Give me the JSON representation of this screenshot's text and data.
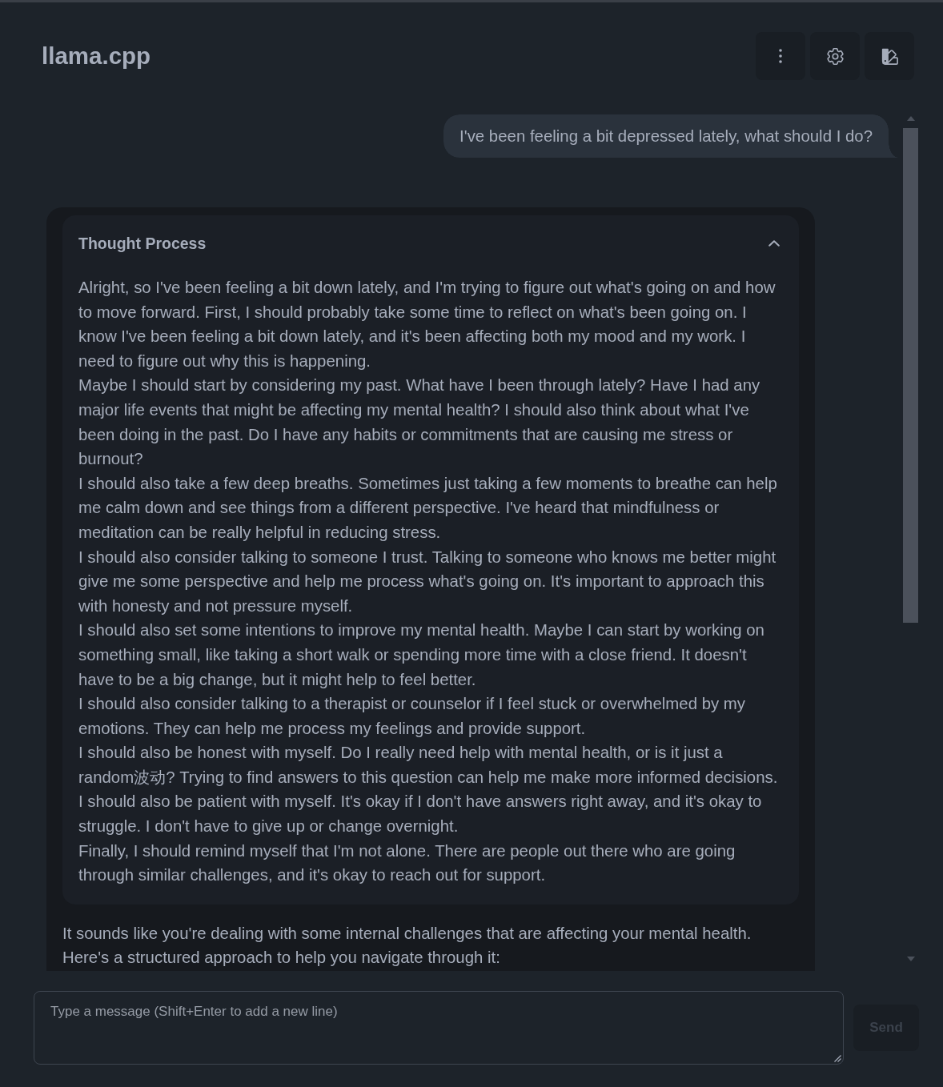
{
  "header": {
    "title": "llama.cpp"
  },
  "messages": [
    {
      "kind": "user",
      "text": "I've been feeling a bit depressed lately, what should I do?"
    },
    {
      "kind": "assistant",
      "thought": {
        "title": "Thought Process",
        "expanded": true,
        "paragraphs": [
          "Alright, so I've been feeling a bit down lately, and I'm trying to figure out what's going on and how to move forward. First, I should probably take some time to reflect on what's been going on. I know I've been feeling a bit down lately, and it's been affecting both my mood and my work. I need to figure out why this is happening.",
          "Maybe I should start by considering my past. What have I been through lately? Have I had any major life events that might be affecting my mental health? I should also think about what I've been doing in the past. Do I have any habits or commitments that are causing me stress or burnout?",
          "I should also take a few deep breaths. Sometimes just taking a few moments to breathe can help me calm down and see things from a different perspective. I've heard that mindfulness or meditation can be really helpful in reducing stress.",
          "I should also consider talking to someone I trust. Talking to someone who knows me better might give me some perspective and help me process what's going on. It's important to approach this with honesty and not pressure myself.",
          "I should also set some intentions to improve my mental health. Maybe I can start by working on something small, like taking a short walk or spending more time with a close friend. It doesn't have to be a big change, but it might help to feel better.",
          "I should also consider talking to a therapist or counselor if I feel stuck or overwhelmed by my emotions. They can help me process my feelings and provide support.",
          "I should also be honest with myself. Do I really need help with mental health, or is it just a random波动? Trying to find answers to this question can help me make more informed decisions.",
          "I should also be patient with myself. It's okay if I don't have answers right away, and it's okay to struggle. I don't have to give up or change overnight.",
          "Finally, I should remind myself that I'm not alone. There are people out there who are going through similar challenges, and it's okay to reach out for support."
        ]
      },
      "text": "It sounds like you're dealing with some internal challenges that are affecting your mental health. Here's a structured approach to help you navigate through it:"
    }
  ],
  "composer": {
    "placeholder": "Type a message (Shift+Enter to add a new line)",
    "send_button": {
      "label": "Send",
      "disabled": true
    }
  }
}
